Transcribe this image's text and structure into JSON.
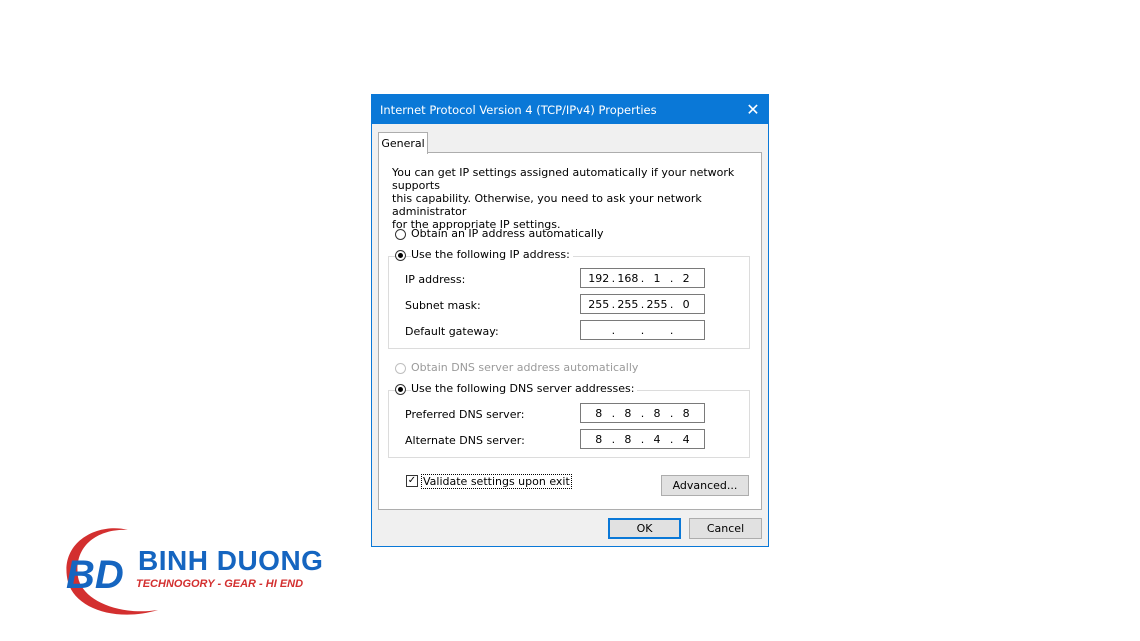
{
  "dialog": {
    "title": "Internet Protocol Version 4 (TCP/IPv4) Properties",
    "close_glyph": "✕",
    "tab_general": "General",
    "description_line1": "You can get IP settings assigned automatically if your network supports",
    "description_line2": "this capability. Otherwise, you need to ask your network administrator",
    "description_line3": "for the appropriate IP settings.",
    "ip_mode": {
      "auto_label": "Obtain an IP address automatically",
      "manual_label": "Use the following IP address:",
      "selected": "manual"
    },
    "ip_fields": {
      "ip_label": "IP address:",
      "ip_value": [
        "192",
        "168",
        "1",
        "2"
      ],
      "subnet_label": "Subnet mask:",
      "subnet_value": [
        "255",
        "255",
        "255",
        "0"
      ],
      "gateway_label": "Default gateway:",
      "gateway_value": [
        "",
        "",
        "",
        ""
      ]
    },
    "dns_mode": {
      "auto_label": "Obtain DNS server address automatically",
      "manual_label": "Use the following DNS server addresses:",
      "selected": "manual"
    },
    "dns_fields": {
      "preferred_label": "Preferred DNS server:",
      "preferred_value": [
        "8",
        "8",
        "8",
        "8"
      ],
      "alternate_label": "Alternate DNS server:",
      "alternate_value": [
        "8",
        "8",
        "4",
        "4"
      ]
    },
    "validate_label": "Validate settings upon exit",
    "validate_checked": true,
    "check_glyph": "✓",
    "advanced_label": "Advanced...",
    "ok_label": "OK",
    "cancel_label": "Cancel",
    "dot": "."
  },
  "logo": {
    "name": "BINH DUONG",
    "tagline": "TECHNOGORY - GEAR - HI END",
    "monogram": "BD",
    "colors": {
      "blue": "#1565c0",
      "red": "#d32f2f"
    }
  },
  "colors": {
    "accent": "#0a78d7",
    "dialog_bg": "#f0f0f0"
  }
}
